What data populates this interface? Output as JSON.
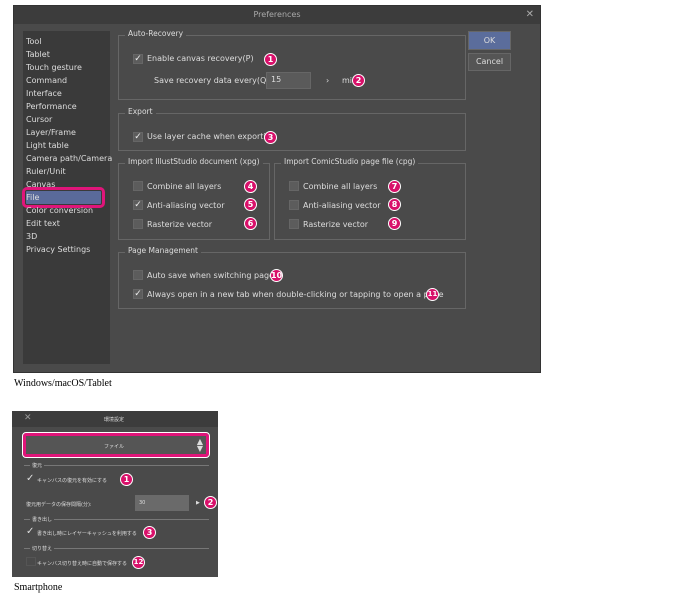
{
  "desktop": {
    "title": "Preferences",
    "close_icon": "close-icon",
    "sidebar": [
      "Tool",
      "Tablet",
      "Touch gesture",
      "Command",
      "Interface",
      "Performance",
      "Cursor",
      "Layer/Frame",
      "Light table",
      "Camera path/Camera",
      "Ruler/Unit",
      "Canvas",
      "File",
      "Color conversion",
      "Edit text",
      "3D",
      "Privacy Settings"
    ],
    "selected": "File",
    "ok": "OK",
    "cancel": "Cancel",
    "auto_recovery": {
      "title": "Auto-Recovery",
      "enable": "Enable canvas recovery(P)",
      "enable_checked": true,
      "save_label": "Save recovery data every(Q):",
      "save_value": "15",
      "unit": "minutes",
      "unit_visible": "mi",
      "arrow": "›"
    },
    "export": {
      "title": "Export",
      "layer_cache": "Use layer cache when exporting",
      "checked": true
    },
    "illust": {
      "title": "Import IllustStudio document (xpg)",
      "items": [
        {
          "label": "Combine all layers",
          "checked": false
        },
        {
          "label": "Anti-aliasing vector",
          "checked": true
        },
        {
          "label": "Rasterize vector",
          "checked": false
        }
      ]
    },
    "comic": {
      "title": "Import ComicStudio page file (cpg)",
      "items": [
        {
          "label": "Combine all layers",
          "checked": false
        },
        {
          "label": "Anti-aliasing vector",
          "checked": false
        },
        {
          "label": "Rasterize vector",
          "checked": false
        }
      ]
    },
    "page": {
      "title": "Page Management",
      "items": [
        {
          "label": "Auto save when switching page",
          "checked": false
        },
        {
          "label": "Always open in a new tab when double-clicking or tapping to open a page",
          "checked": true
        }
      ]
    },
    "badges": [
      "1",
      "2",
      "3",
      "4",
      "5",
      "6",
      "7",
      "8",
      "9",
      "10",
      "11"
    ],
    "caption": "Windows/macOS/Tablet"
  },
  "phone": {
    "title": "環境設定",
    "close": "✕",
    "category": "ファイル",
    "sec1": "復元",
    "enable": "キャンバスの復元を有効にする",
    "interval_label": "復元用データの保存間隔(分):",
    "interval_value": "30",
    "sec2": "書き出し",
    "cache": "書き出し時にレイヤーキャッシュを利用する",
    "sec3": "切り替え",
    "autosave": "キャンバス切り替え時に自動で保存する",
    "badges": [
      "1",
      "2",
      "3",
      "12"
    ],
    "caption": "Smartphone"
  },
  "colors": {
    "accent": "#d8106a",
    "selected": "#5a6a9a"
  }
}
